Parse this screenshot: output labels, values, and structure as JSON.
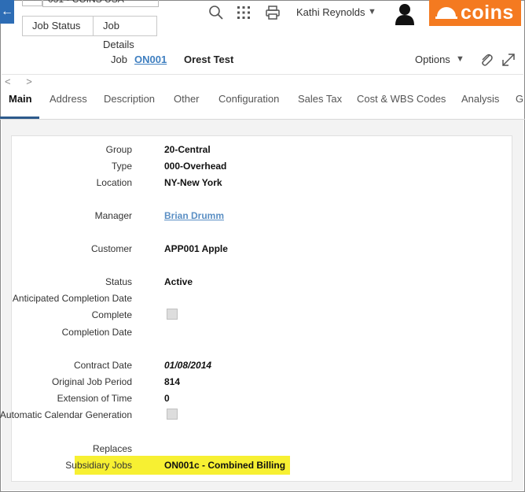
{
  "header": {
    "back_icon": "arrow-left-icon",
    "company_crumb": "031 - COINS USA",
    "crumbs": [
      "Job Status",
      "Job Details"
    ],
    "user_name": "Kathi Reynolds",
    "logo_text": "coins",
    "brand_color": "#f47a20",
    "accent_color": "#2d6db5"
  },
  "job": {
    "label": "Job",
    "code": "ON001",
    "name": "Orest Test",
    "options_label": "Options"
  },
  "tabs": [
    "Main",
    "Address",
    "Description",
    "Other",
    "Configuration",
    "Sales Tax",
    "Cost & WBS Codes",
    "Analysis",
    "G"
  ],
  "active_tab": "Main",
  "fields": {
    "group": {
      "label": "Group",
      "value": "20-Central"
    },
    "type": {
      "label": "Type",
      "value": "000-Overhead"
    },
    "location": {
      "label": "Location",
      "value": "NY-New York"
    },
    "manager": {
      "label": "Manager",
      "value": "Brian Drumm"
    },
    "customer": {
      "label": "Customer",
      "value": "APP001 Apple"
    },
    "status": {
      "label": "Status",
      "value": "Active"
    },
    "anticipated_completion_date": {
      "label": "Anticipated Completion Date",
      "value": ""
    },
    "complete": {
      "label": "Complete",
      "checked": false
    },
    "completion_date": {
      "label": "Completion Date",
      "value": ""
    },
    "contract_date": {
      "label": "Contract Date",
      "value": "01/08/2014"
    },
    "original_job_period": {
      "label": "Original Job Period",
      "value": "814"
    },
    "extension_of_time": {
      "label": "Extension of Time",
      "value": "0"
    },
    "automatic_calendar_generation": {
      "label": "Automatic Calendar Generation",
      "checked": false
    },
    "replaces": {
      "label": "Replaces",
      "value": ""
    },
    "subsidiary_jobs": {
      "label": "Subsidiary Jobs",
      "value": "ON001c - Combined Billing"
    }
  },
  "highlight_color": "#f7f032"
}
